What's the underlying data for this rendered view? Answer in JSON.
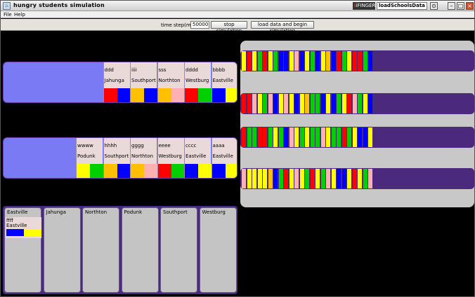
{
  "window": {
    "title": "hungry students simulation",
    "brand": "iFINGER",
    "title_input": "loadSchoolsData",
    "controls": [
      "magnify-icon",
      "minimize-icon",
      "maximize-icon",
      "close-icon"
    ]
  },
  "menu": {
    "items": [
      "File",
      "Help"
    ]
  },
  "toolbar": {
    "time_step_label": "time step(millis)",
    "time_step_value": "50000",
    "stop_label": "stop simulation",
    "load_label": "load data and begin simulation"
  },
  "colors": {
    "R": "#ff0000",
    "B": "#0000ff",
    "Y": "#ffff00",
    "G": "#00d000",
    "O": "#ffc000",
    "P": "#ffb0b0",
    "panel": "#7a7af5",
    "queue": "#4b2a7e"
  },
  "buses": [
    {
      "slots": [
        {
          "name": "ddd",
          "city": "Jahunga",
          "colors": [
            "R",
            "B"
          ]
        },
        {
          "name": "iiii",
          "city": "Southport",
          "colors": [
            "O",
            "B"
          ]
        },
        {
          "name": "sss",
          "city": "Northton",
          "colors": [
            "O",
            "P"
          ]
        },
        {
          "name": "dddd",
          "city": "Westburg",
          "colors": [
            "R",
            "G"
          ]
        },
        {
          "name": "bbbb",
          "city": "Eastville",
          "colors": [
            "B",
            "Y"
          ]
        }
      ]
    },
    {
      "slots": [
        {
          "name": "wwww",
          "city": "Podunk",
          "colors": [
            "Y",
            "G"
          ]
        },
        {
          "name": "hhhh",
          "city": "Southport",
          "colors": [
            "O",
            "B"
          ]
        },
        {
          "name": "gggg",
          "city": "Northton",
          "colors": [
            "O",
            "P"
          ]
        },
        {
          "name": "eeee",
          "city": "Westburg",
          "colors": [
            "R",
            "G"
          ]
        },
        {
          "name": "cccc",
          "city": "Eastville",
          "colors": [
            "B",
            "Y"
          ]
        },
        {
          "name": "aaaa",
          "city": "Eastville",
          "colors": [
            "B",
            "Y"
          ]
        }
      ]
    }
  ],
  "queues": [
    "YRYGRYGBBYPBYGBYOBRGYRRGB",
    "RRPYGPBYPYBYOGGBYBGYRPGYB",
    "RGGRRGYGBPYGYGGPYGGRGYBBY",
    "PYYYYOBGRYPYGRYGPYBBYRYGP"
  ],
  "cafeterias": [
    {
      "name": "Eastville",
      "tray": {
        "name": "ffff",
        "city": "Eastville",
        "colors": [
          "B",
          "Y"
        ]
      }
    },
    {
      "name": "Jahunga"
    },
    {
      "name": "Northton"
    },
    {
      "name": "Podunk"
    },
    {
      "name": "Southport"
    },
    {
      "name": "Westburg"
    }
  ]
}
